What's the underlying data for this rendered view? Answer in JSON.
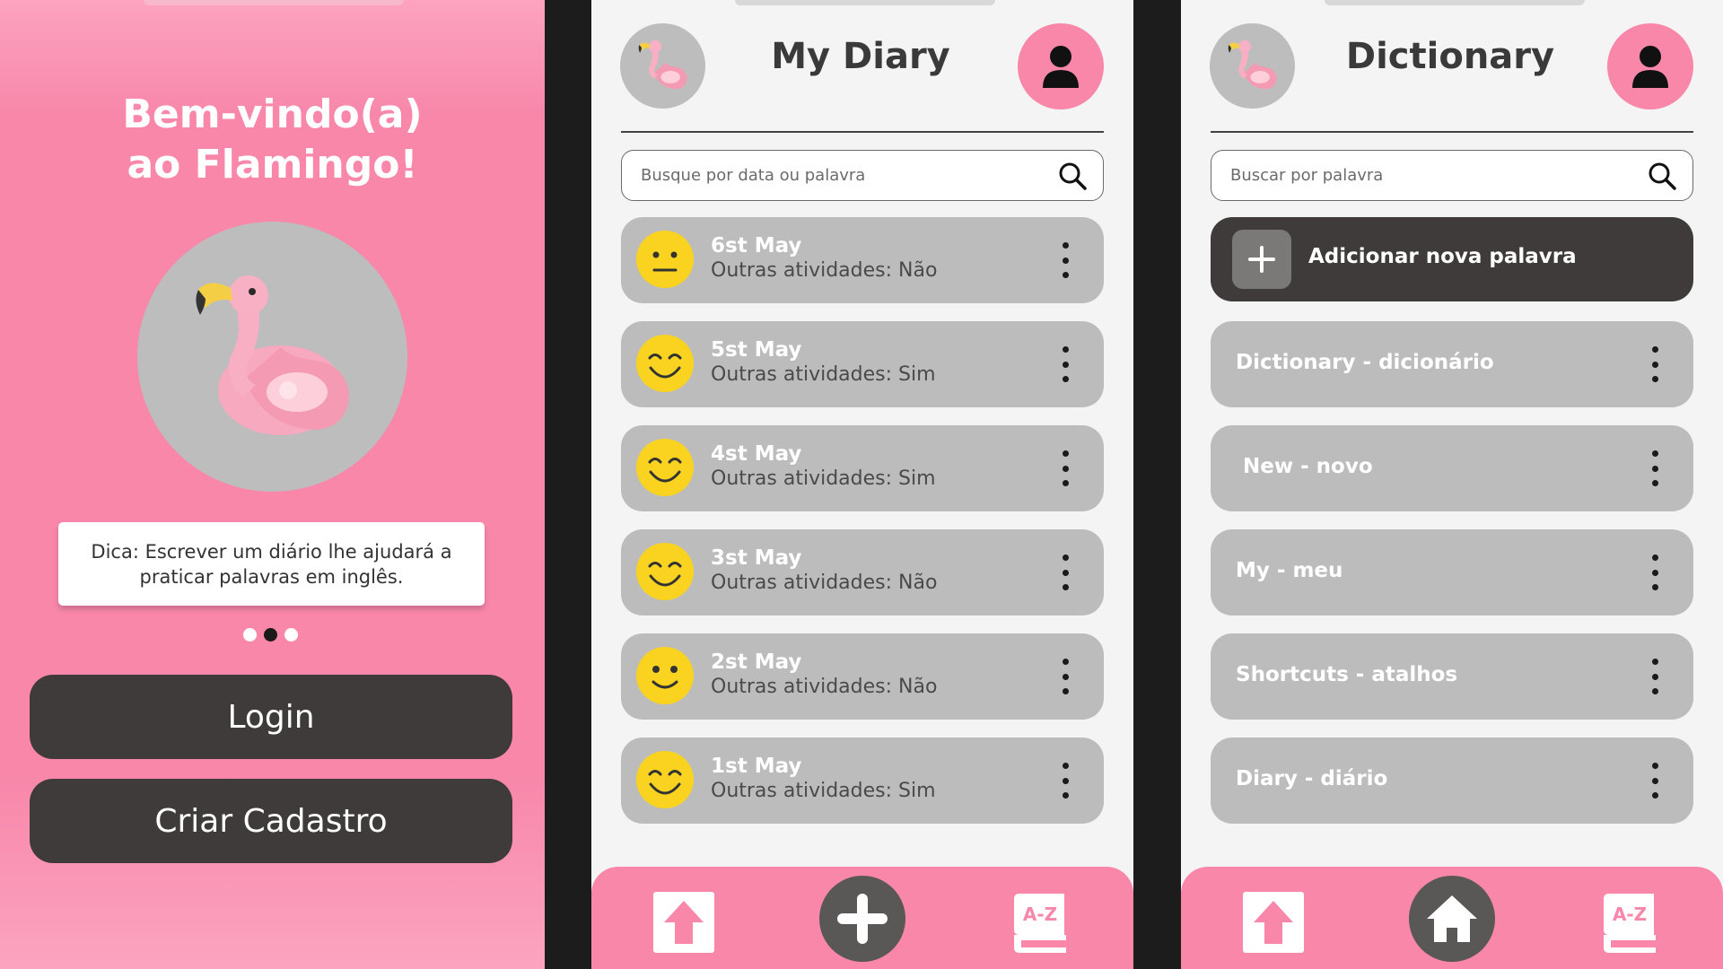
{
  "colors": {
    "brand_pink": "#f887aa",
    "dark_button": "#3f3b3b",
    "card_gray": "#bcbcbc",
    "emoji_yellow": "#f9d31f"
  },
  "welcome": {
    "title_line1": "Bem-vindo(a)",
    "title_line2": "ao Flamingo!",
    "tip": "Dica: Escrever um diário lhe ajudará a praticar palavras em inglês.",
    "carousel": {
      "total": 3,
      "active": 2
    },
    "login_label": "Login",
    "signup_label": "Criar Cadastro"
  },
  "diary": {
    "title": "My Diary",
    "search_placeholder": "Busque por data ou palavra",
    "entries": [
      {
        "date": "6st May",
        "activities": "Outras atividades: Não",
        "mood": "neutral"
      },
      {
        "date": "5st May",
        "activities": "Outras atividades: Sim",
        "mood": "happy"
      },
      {
        "date": "4st May",
        "activities": "Outras atividades: Sim",
        "mood": "happy"
      },
      {
        "date": "3st May",
        "activities": "Outras atividades: Não",
        "mood": "happy"
      },
      {
        "date": "2st May",
        "activities": "Outras atividades: Não",
        "mood": "slight-smile"
      },
      {
        "date": "1st May",
        "activities": "Outras atividades: Sim",
        "mood": "happy"
      }
    ],
    "tabbar": {
      "left_icon": "upload-icon",
      "center_icon": "plus-icon",
      "right_icon": "dictionary-az-icon",
      "right_label": "A-Z"
    }
  },
  "dictionary": {
    "title": "Dictionary",
    "search_placeholder": "Buscar por palavra",
    "add_label": "Adicionar nova palavra",
    "words": [
      "Dictionary - dicionário",
      " New - novo",
      "My - meu",
      "Shortcuts - atalhos",
      "Diary - diário"
    ],
    "tabbar": {
      "left_icon": "upload-icon",
      "center_icon": "home-icon",
      "right_icon": "dictionary-az-icon",
      "right_label": "A-Z"
    }
  }
}
